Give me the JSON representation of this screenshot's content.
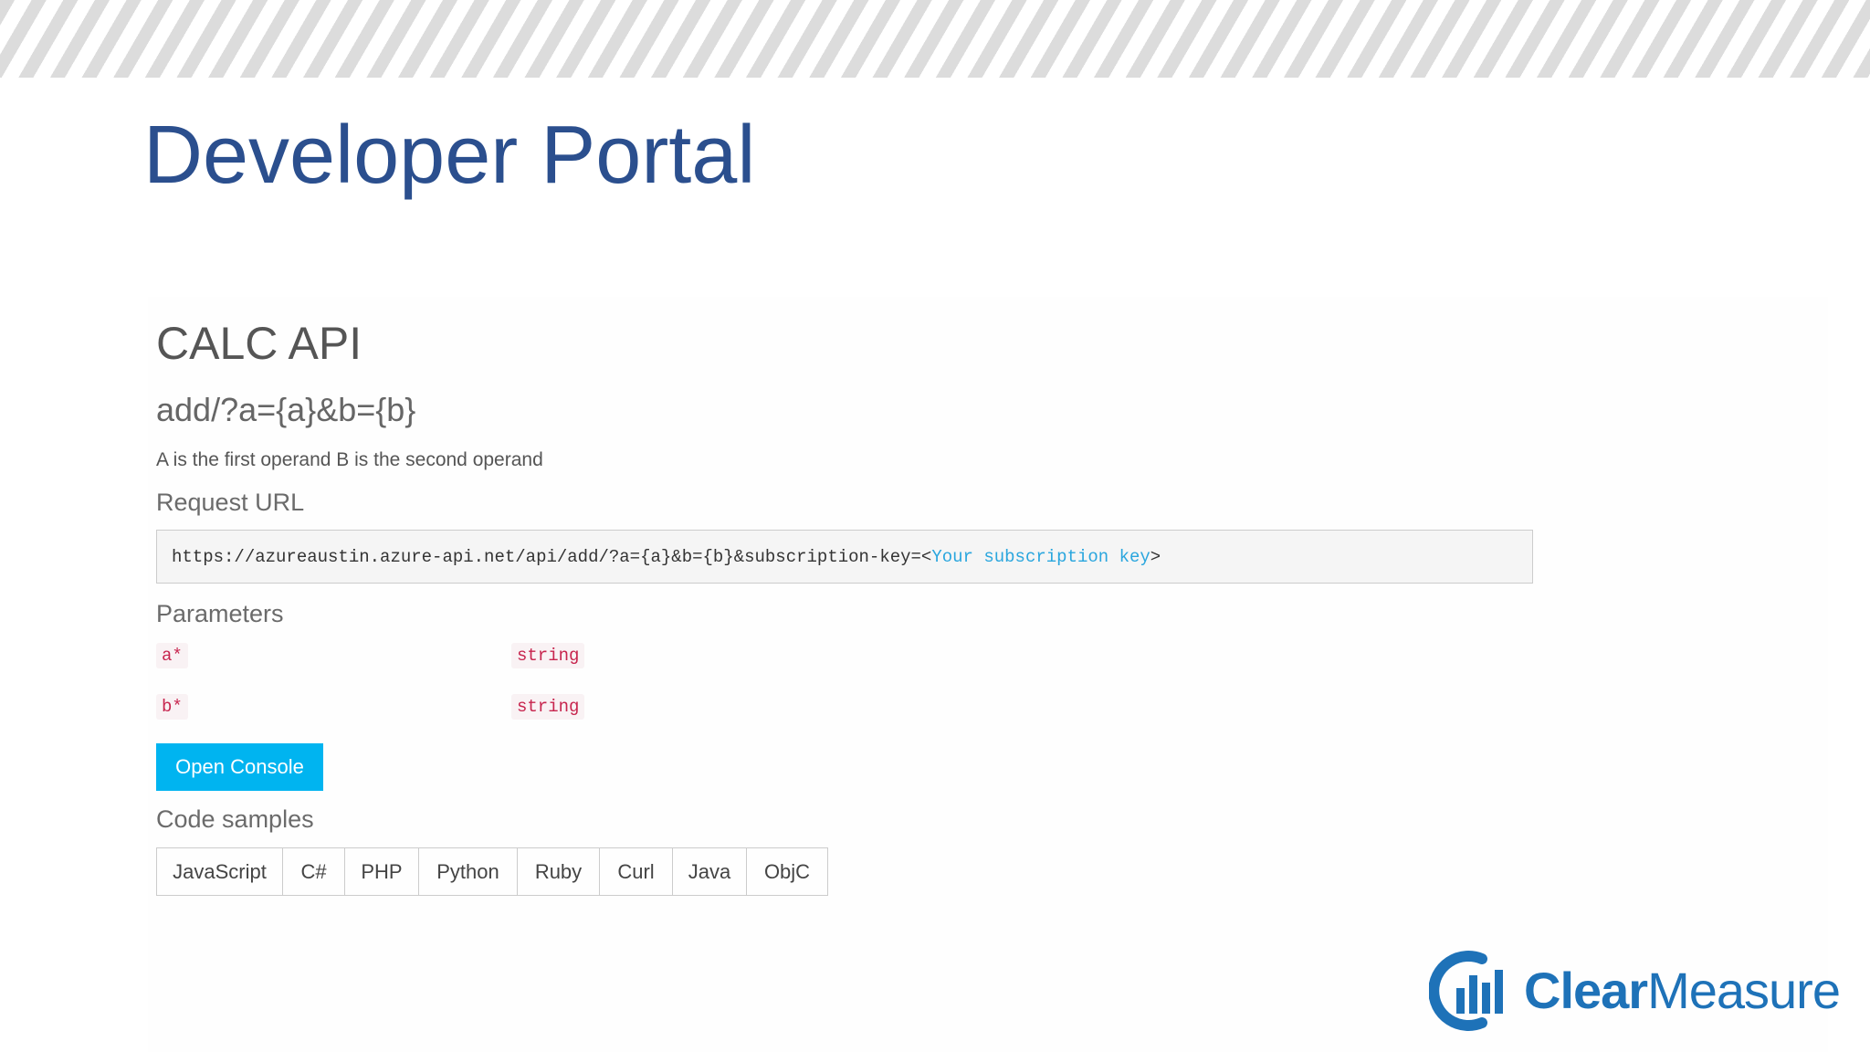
{
  "slide": {
    "title": "Developer Portal"
  },
  "api": {
    "name": "CALC API",
    "operation": "add/?a={a}&b={b}",
    "description": "A is the first operand B is the second operand"
  },
  "request_url": {
    "label": "Request URL",
    "base": "https://azureaustin.azure-api.net/api/add/?a={a}&b={b}&subscription-key=<",
    "key_placeholder": "Your subscription key",
    "suffix": ">"
  },
  "parameters": {
    "label": "Parameters",
    "items": [
      {
        "name": "a*",
        "type": "string"
      },
      {
        "name": "b*",
        "type": "string"
      }
    ]
  },
  "console_button": {
    "label": "Open Console"
  },
  "code_samples": {
    "label": "Code samples",
    "tabs": [
      "JavaScript",
      "C#",
      "PHP",
      "Python",
      "Ruby",
      "Curl",
      "Java",
      "ObjC"
    ]
  },
  "logo": {
    "word_bold": "Clear",
    "word_light": "Measure",
    "color": "#1e72b8"
  },
  "colors": {
    "title": "#2b4f8e",
    "button": "#00b4f0",
    "param_text": "#c7254e",
    "url_key": "#2aa6de"
  }
}
